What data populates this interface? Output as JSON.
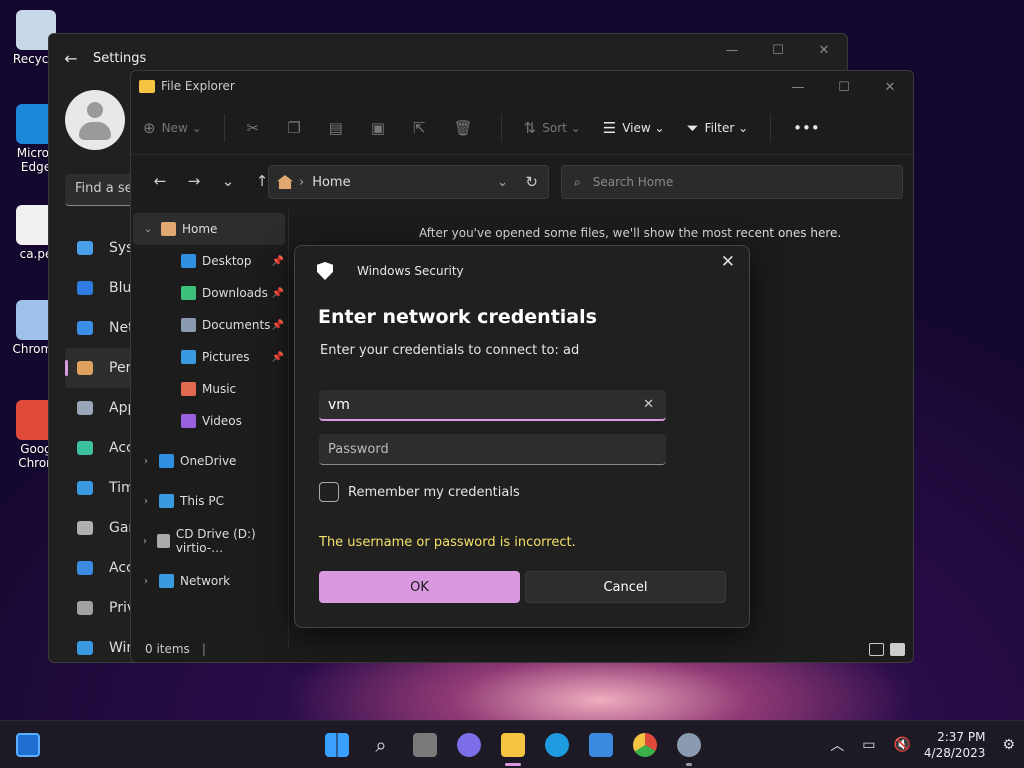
{
  "desktop": {
    "icons": [
      {
        "label": "Recycle",
        "color": "#c8d8e8"
      },
      {
        "label": "Micros Edge",
        "color": "#1e88d8"
      },
      {
        "label": "ca.pe",
        "color": "#f0f0f0"
      },
      {
        "label": "Chrome",
        "color": "#9fc0e8"
      },
      {
        "label": "Goog Chron",
        "color": "#e04a3a"
      }
    ]
  },
  "settings": {
    "title": "Settings",
    "search_placeholder": "Find a se",
    "nav": [
      {
        "label": "Syst",
        "icon": "monitor-icon",
        "color": "#4aa0e8"
      },
      {
        "label": "Blue",
        "icon": "bluetooth-icon",
        "color": "#2f7be0"
      },
      {
        "label": "Net",
        "icon": "wifi-icon",
        "color": "#3b8fe6"
      },
      {
        "label": "Pers",
        "icon": "brush-icon",
        "color": "#e0a060"
      },
      {
        "label": "App",
        "icon": "apps-icon",
        "color": "#9aa6b8"
      },
      {
        "label": "Acc",
        "icon": "person-icon",
        "color": "#3cc0a0"
      },
      {
        "label": "Tim",
        "icon": "clock-icon",
        "color": "#3a9ae0"
      },
      {
        "label": "Gar",
        "icon": "gamepad-icon",
        "color": "#b0b0b0"
      },
      {
        "label": "Acc",
        "icon": "accessibility-icon",
        "color": "#3a8ae0"
      },
      {
        "label": "Priv",
        "icon": "shield-icon",
        "color": "#a0a0a0"
      },
      {
        "label": "Win",
        "icon": "update-icon",
        "color": "#3a9ae0"
      }
    ]
  },
  "explorer": {
    "title": "File Explorer",
    "toolbar": {
      "new": "New",
      "sort": "Sort",
      "view": "View",
      "filter": "Filter"
    },
    "address": "Home",
    "search_placeholder": "Search Home",
    "sidebar": [
      {
        "label": "Home",
        "level": 0,
        "selected": true,
        "chevron": "⌄",
        "color": "#e0a870",
        "pinned": false
      },
      {
        "label": "Desktop",
        "level": 1,
        "color": "#2f8fe0",
        "pinned": true
      },
      {
        "label": "Downloads",
        "level": 1,
        "color": "#3cc07a",
        "pinned": true
      },
      {
        "label": "Documents",
        "level": 1,
        "color": "#8a9ab0",
        "pinned": true
      },
      {
        "label": "Pictures",
        "level": 1,
        "color": "#3a9ae0",
        "pinned": true
      },
      {
        "label": "Music",
        "level": 1,
        "color": "#e06a50",
        "pinned": false
      },
      {
        "label": "Videos",
        "level": 1,
        "color": "#9a60e0",
        "pinned": false
      },
      {
        "label": "OneDrive",
        "level": 0,
        "chevron": "›",
        "color": "#2f8fe0",
        "pinned": false
      },
      {
        "label": "This PC",
        "level": 0,
        "chevron": "›",
        "color": "#3a9ae0",
        "pinned": false
      },
      {
        "label": "CD Drive (D:) virtio-…",
        "level": 0,
        "chevron": "›",
        "color": "#aaaaaa",
        "pinned": false
      },
      {
        "label": "Network",
        "level": 0,
        "chevron": "›",
        "color": "#3a9ae0",
        "pinned": false
      }
    ],
    "empty_message": "After you've opened some files, we'll show the most recent ones here.",
    "status": "0 items"
  },
  "dialog": {
    "app_name": "Windows Security",
    "heading": "Enter network credentials",
    "subtitle": "Enter your credentials to connect to: ad",
    "username_value": "vm",
    "password_placeholder": "Password",
    "remember_label": "Remember my credentials",
    "error": "The username or password is incorrect.",
    "ok_label": "OK",
    "cancel_label": "Cancel",
    "accent": "#d999e0",
    "error_color": "#f3e06a"
  },
  "taskbar": {
    "time": "2:37 PM",
    "date": "4/28/2023"
  }
}
